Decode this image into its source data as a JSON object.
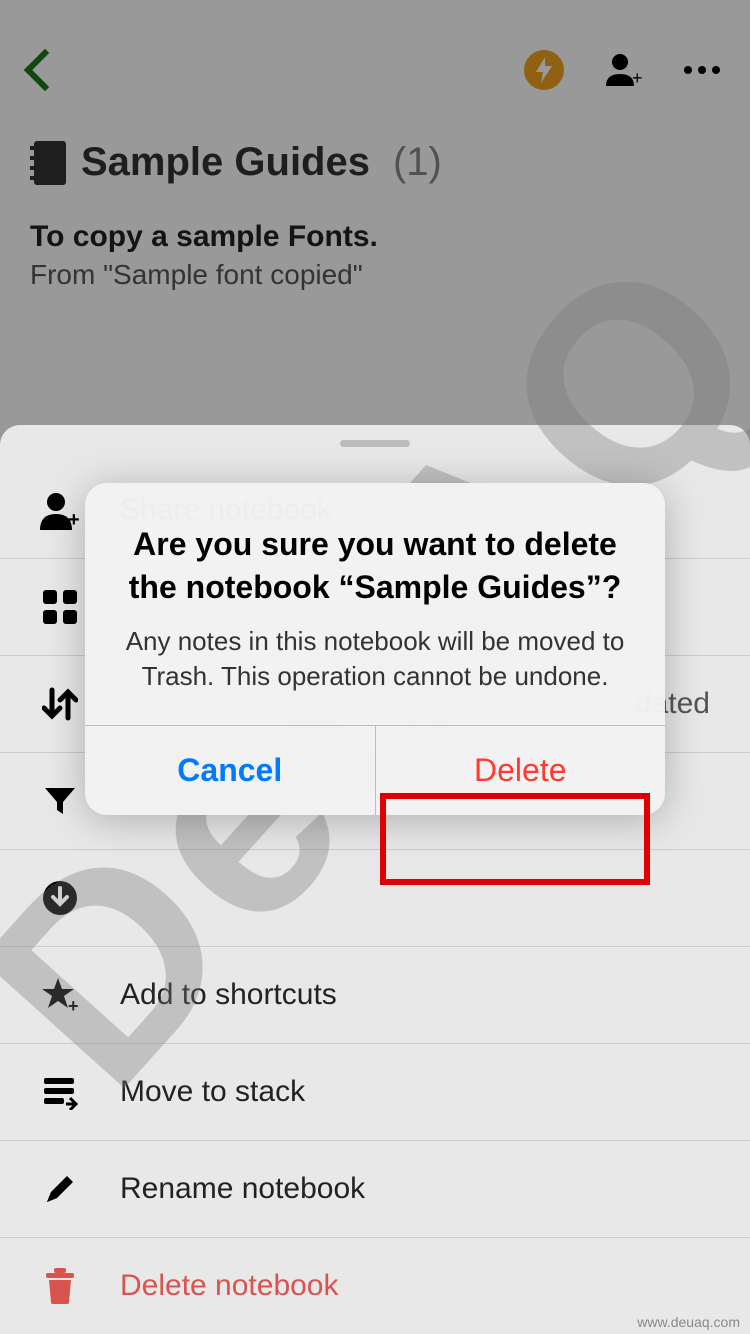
{
  "header": {
    "notebook_title": "Sample Guides",
    "notebook_count": "(1)",
    "note_title": "To copy a sample Fonts.",
    "note_subtitle": "From \"Sample font copied\""
  },
  "sheet": {
    "items": [
      {
        "label": "Share notebook",
        "icon": "person-add"
      },
      {
        "label": "",
        "icon": "grid",
        "right": ""
      },
      {
        "label": "",
        "icon": "sort",
        "right": "dated"
      },
      {
        "label": "",
        "icon": "filter"
      },
      {
        "label": "",
        "icon": "download"
      },
      {
        "label": "Add to shortcuts",
        "icon": "star-add"
      },
      {
        "label": "Move to stack",
        "icon": "stack"
      },
      {
        "label": "Rename notebook",
        "icon": "pencil"
      },
      {
        "label": "Delete notebook",
        "icon": "trash",
        "danger": true
      }
    ]
  },
  "alert": {
    "title": "Are you sure you want to delete the notebook “Sample Guides”?",
    "message": "Any notes in this notebook will be moved to Trash. This operation cannot be undone.",
    "cancel": "Cancel",
    "delete": "Delete"
  },
  "watermark": "DeuAQ",
  "attribution": "www.deuaq.com"
}
